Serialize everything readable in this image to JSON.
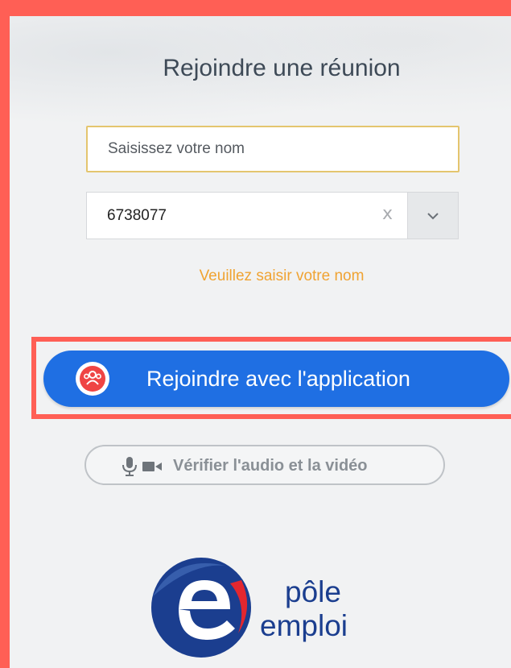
{
  "dialog": {
    "title": "Rejoindre une réunion",
    "name_placeholder": "Saisissez votre nom",
    "name_value": "",
    "meeting_id": "6738077",
    "clear_glyph": "x",
    "hint": "Veuillez saisir votre nom",
    "join_app_label": "Rejoindre avec l'application",
    "check_av_label": "Vérifier l'audio et la vidéo"
  },
  "logo": {
    "line1": "pôle",
    "line2": "emploi"
  },
  "icons": {
    "clear": "close-icon",
    "dropdown": "chevron-down-icon",
    "join": "people-group-icon",
    "mic": "microphone-icon",
    "camera": "video-camera-icon"
  },
  "colors": {
    "frame_red": "#ff5f55",
    "primary_blue": "#1f6fe3",
    "hint_orange": "#f0a332",
    "field_focus_border": "#e4c56e",
    "logo_blue": "#1b3e8f",
    "logo_red": "#e3272f"
  }
}
